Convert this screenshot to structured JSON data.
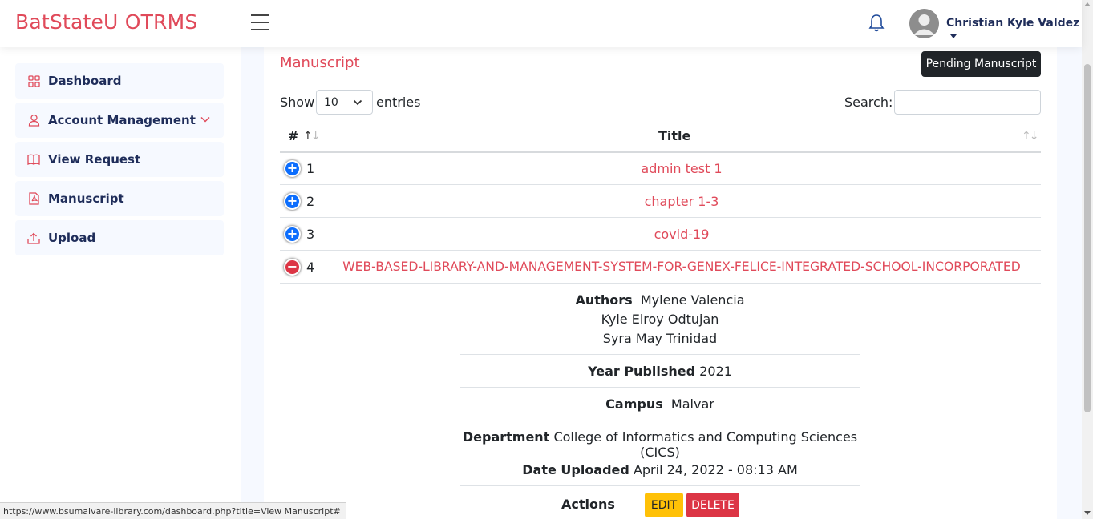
{
  "app": {
    "brand": "BatStateU OTRMS"
  },
  "header": {
    "user_name": "Christian Kyle Valdez"
  },
  "sidebar": {
    "items": [
      {
        "label": "Dashboard",
        "icon": "grid-icon"
      },
      {
        "label": "Account Management",
        "icon": "person-icon"
      },
      {
        "label": "View Request",
        "icon": "book-icon"
      },
      {
        "label": "Manuscript",
        "icon": "file-pdf-icon"
      },
      {
        "label": "Upload",
        "icon": "upload-icon"
      }
    ]
  },
  "main": {
    "title": "Manuscript",
    "tooltip": "Pending Manuscript",
    "show_label": "Show",
    "entries_value": "10",
    "entries_label": "entries",
    "search_label": "Search:",
    "columns": [
      "#",
      "Title"
    ],
    "rows": [
      {
        "num": "1",
        "title": "admin test 1",
        "expanded": false
      },
      {
        "num": "2",
        "title": "chapter 1-3",
        "expanded": false
      },
      {
        "num": "3",
        "title": "covid-19",
        "expanded": false
      },
      {
        "num": "4",
        "title": "WEB-BASED-LIBRARY-AND-MANAGEMENT-SYSTEM-FOR-GENEX-FELICE-INTEGRATED-SCHOOL-INCORPORATED",
        "expanded": true
      }
    ],
    "details": {
      "authors_label": "Authors",
      "authors": [
        "Mylene Valencia",
        "Kyle Elroy Odtujan",
        "Syra May Trinidad"
      ],
      "year_label": "Year Published",
      "year": "2021",
      "campus_label": "Campus",
      "campus": "Malvar",
      "department_label": "Department",
      "department": "College of Informatics and Computing Sciences (CICS)",
      "date_label": "Date Uploaded",
      "date": "April 24, 2022 - 08:13 AM",
      "actions_label": "Actions",
      "edit_label": "EDIT",
      "delete_label": "DELETE"
    }
  },
  "statusbar": {
    "url": "https://www.bsumalvare-library.com/dashboard.php?title=View Manuscript#"
  },
  "colors": {
    "brand": "#e04a5a",
    "nav_text": "#1f2d5a",
    "edit": "#ffc107",
    "delete": "#dc3545",
    "expand": "#0d6efd"
  }
}
